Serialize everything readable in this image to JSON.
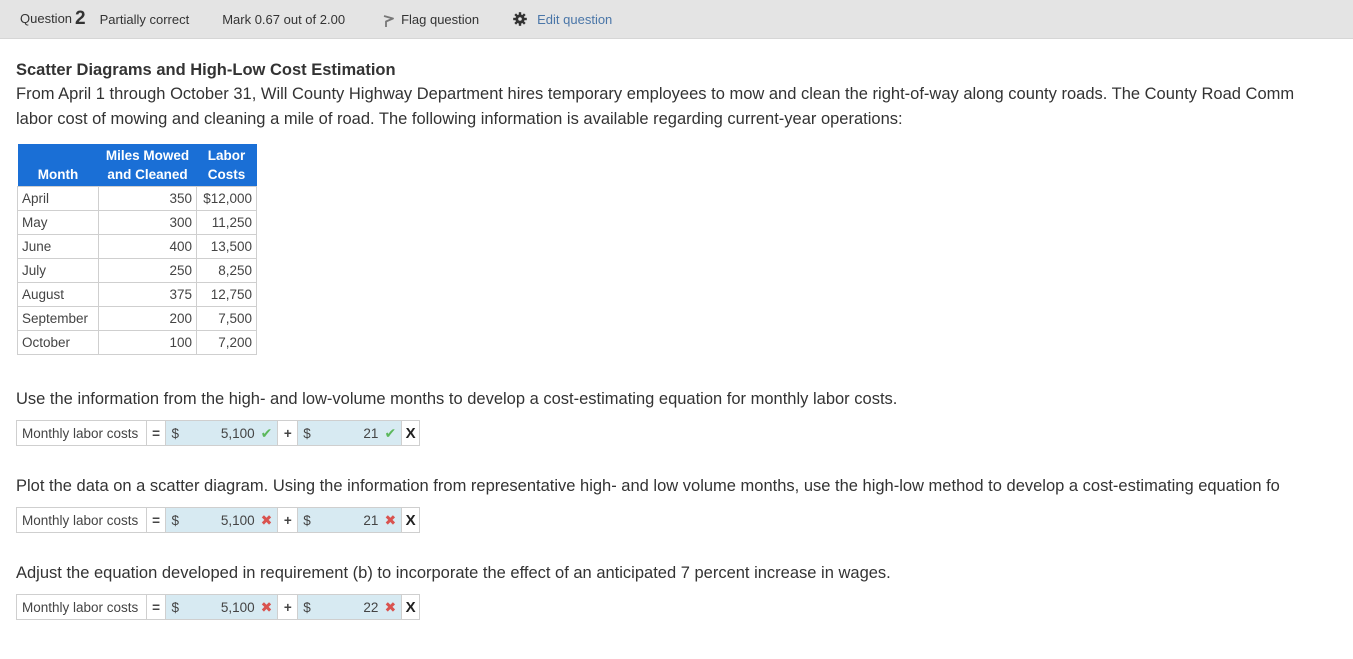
{
  "header": {
    "question_label": "Question",
    "question_number": "2",
    "state": "Partially correct",
    "mark": "Mark 0.67 out of 2.00",
    "flag_label": "Flag question",
    "edit_label": "Edit question"
  },
  "question": {
    "title": "Scatter Diagrams and High-Low Cost Estimation",
    "intro_line1": "From April 1 through October 31, Will County Highway Department hires temporary employees to mow and clean the right-of-way along county roads. The County Road Comm",
    "intro_line2": "labor cost of mowing and cleaning a mile of road. The following information is available regarding current-year operations:"
  },
  "table": {
    "headers": {
      "month": "Month",
      "miles_line1": "Miles Mowed",
      "miles_line2": "and Cleaned",
      "labor_line1": "Labor",
      "labor_line2": "Costs"
    },
    "rows": [
      {
        "month": "April",
        "miles": "350",
        "labor": "$12,000"
      },
      {
        "month": "May",
        "miles": "300",
        "labor": "11,250"
      },
      {
        "month": "June",
        "miles": "400",
        "labor": "13,500"
      },
      {
        "month": "July",
        "miles": "250",
        "labor": "8,250"
      },
      {
        "month": "August",
        "miles": "375",
        "labor": "12,750"
      },
      {
        "month": "September",
        "miles": "200",
        "labor": "7,500"
      },
      {
        "month": "October",
        "miles": "100",
        "labor": "7,200"
      }
    ]
  },
  "requirements": [
    {
      "prompt": "Use the information from the high- and low-volume months to develop a cost-estimating equation for monthly labor costs.",
      "label": "Monthly labor costs",
      "equals": "=",
      "plus": "+",
      "currency": "$",
      "fixed_value": "5,100",
      "fixed_status": "correct",
      "variable_value": "21",
      "variable_status": "correct",
      "trailing": "X"
    },
    {
      "prompt": "Plot the data on a scatter diagram. Using the information from representative high- and low volume months, use the high-low method to develop a cost-estimating equation fo",
      "label": "Monthly labor costs",
      "equals": "=",
      "plus": "+",
      "currency": "$",
      "fixed_value": "5,100",
      "fixed_status": "incorrect",
      "variable_value": "21",
      "variable_status": "incorrect",
      "trailing": "X"
    },
    {
      "prompt": "Adjust the equation developed in requirement (b) to incorporate the effect of an anticipated 7 percent increase in wages.",
      "label": "Monthly labor costs",
      "equals": "=",
      "plus": "+",
      "currency": "$",
      "fixed_value": "5,100",
      "fixed_status": "incorrect",
      "variable_value": "22",
      "variable_status": "incorrect",
      "trailing": "X"
    }
  ],
  "marks": {
    "correct": "✔",
    "incorrect": "✖"
  },
  "colors": {
    "header_bg": "#e4e4e4",
    "table_header_bg": "#1a6fd6",
    "answer_cell_bg": "#d7eaf2",
    "correct": "#5cb85c",
    "incorrect": "#d9534f",
    "link": "#4a76a8"
  }
}
